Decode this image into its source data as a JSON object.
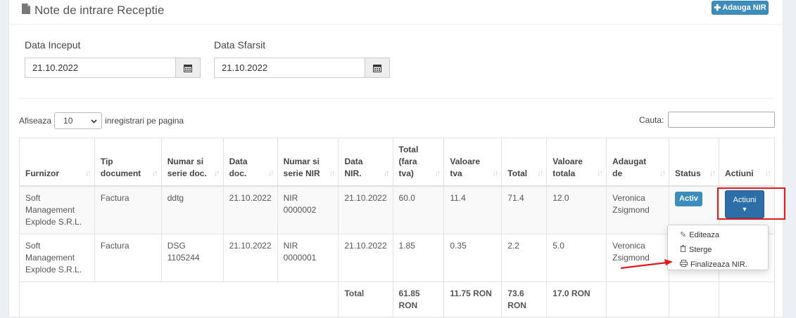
{
  "header": {
    "title": "Note de intrare Receptie",
    "add_button": "Adauga NIR"
  },
  "filters": {
    "start_label": "Data Inceput",
    "start_value": "21.10.2022",
    "end_label": "Data Sfarsit",
    "end_value": "21.10.2022"
  },
  "paging": {
    "show_prefix": "Afiseaza",
    "page_size": "10",
    "show_suffix": "inregistrari pe pagina",
    "search_label": "Cauta:"
  },
  "columns": [
    "Furnizor",
    "Tip document",
    "Numar si serie doc.",
    "Data doc.",
    "Numar si serie NIR",
    "Data NIR.",
    "Total (fara tva)",
    "Valoare tva",
    "Total",
    "Valoare totala",
    "Adaugat de",
    "Status",
    "Actiuni"
  ],
  "rows": [
    {
      "furnizor": "Soft Management Explode S.R.L.",
      "tip": "Factura",
      "doc": "ddtg",
      "data_doc": "21.10.2022",
      "nir": "NIR 0000002",
      "data_nir": "21.10.2022",
      "total_fara": "60.0",
      "tva": "11.4",
      "total": "71.4",
      "valoare": "12.0",
      "adaugat": "Veronica Zsigmond",
      "status": "Activ"
    },
    {
      "furnizor": "Soft Management Explode S.R.L.",
      "tip": "Factura",
      "doc": "DSG 1105244",
      "data_doc": "21.10.2022",
      "nir": "NIR 0000001",
      "data_nir": "21.10.2022",
      "total_fara": "1.85",
      "tva": "0.35",
      "total": "2.2",
      "valoare": "5.0",
      "adaugat": "Veronica Zsigmond",
      "status": ""
    }
  ],
  "footer": {
    "label": "Total",
    "total_fara": "61.85 RON",
    "tva": "11.75 RON",
    "total": "73.6 RON",
    "valoare": "17.0 RON"
  },
  "actions": {
    "button": "Actiuni",
    "menu": [
      "Editeaza",
      "Sterge",
      "Finalizeaza NIR."
    ]
  },
  "colors": {
    "primary": "#3c8dbc",
    "highlight": "#e01b1b"
  }
}
